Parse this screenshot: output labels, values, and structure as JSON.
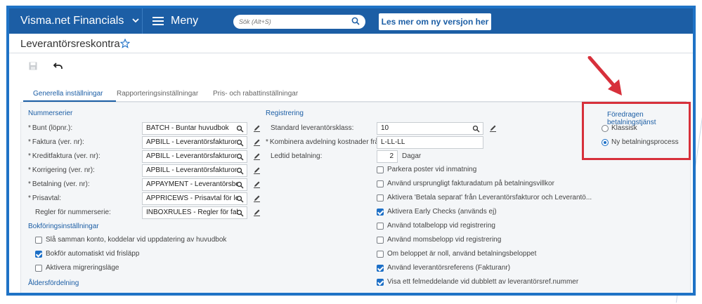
{
  "topbar": {
    "brand": "Visma.net Financials",
    "menu_label": "Meny",
    "search_placeholder": "Sök (Alt+S)",
    "new_version_button": "Les mer om ny versjon her"
  },
  "page": {
    "title": "Leverantörsreskontra"
  },
  "tabs": [
    {
      "label": "Generella inställningar",
      "active": true
    },
    {
      "label": "Rapporteringsinställningar",
      "active": false
    },
    {
      "label": "Pris- och rabattinställningar",
      "active": false
    }
  ],
  "numbering": {
    "section": "Nummerserier",
    "rows": [
      {
        "label": "Bunt (löpnr.):",
        "required": "*",
        "value": "BATCH - Buntar huvudbok"
      },
      {
        "label": "Faktura (ver. nr):",
        "required": "*",
        "value": "APBILL - Leverantörsfakturor"
      },
      {
        "label": "Kreditfaktura (ver. nr):",
        "required": "*",
        "value": "APBILL - Leverantörsfakturor"
      },
      {
        "label": "Korrigering (ver. nr):",
        "required": "*",
        "value": "APBILL - Leverantörsfakturor"
      },
      {
        "label": "Betalning (ver. nr):",
        "required": "*",
        "value": "APPAYMENT - Leverantörsbeta"
      },
      {
        "label": "Prisavtal:",
        "required": "*",
        "value": "APPRICEWS - Prisavtal för leve"
      },
      {
        "label": "Regler för nummerserie:",
        "required": "",
        "value": "INBOXRULES - Regler för faktu"
      }
    ]
  },
  "posting": {
    "section": "Bokföringsinställningar",
    "options": [
      {
        "label": "Slå samman konto, koddelar vid uppdatering av huvudbok",
        "checked": false
      },
      {
        "label": "Bokför automatiskt vid frisläpp",
        "checked": true
      },
      {
        "label": "Aktivera migreringsläge",
        "checked": false
      }
    ]
  },
  "aging": {
    "section": "Åldersfördelning"
  },
  "registration": {
    "section": "Registrering",
    "default_class_label": "Standard leverantörsklass:",
    "default_class_value": "10",
    "combine_label": "Kombinera avdelning kostnader från:",
    "combine_required": "*",
    "combine_value": "L-LL-LL",
    "lead_time_label": "Ledtid betalning:",
    "lead_time_value": "2",
    "lead_time_unit": "Dagar",
    "options": [
      {
        "label": "Parkera poster vid inmatning",
        "checked": false
      },
      {
        "label": "Använd ursprungligt fakturadatum på betalningsvillkor",
        "checked": false
      },
      {
        "label": "Aktivera 'Betala separat' från Leverantörsfakturor och Leverantö...",
        "checked": false
      },
      {
        "label": "Aktivera Early Checks (används ej)",
        "checked": true
      },
      {
        "label": "Använd totalbelopp vid registrering",
        "checked": false
      },
      {
        "label": "Använd momsbelopp vid registrering",
        "checked": false
      },
      {
        "label": "Om beloppet är noll, använd betalningsbeloppet",
        "checked": false
      },
      {
        "label": "Använd leverantörsreferens (Fakturanr)",
        "checked": true
      },
      {
        "label": "Visa ett felmeddelande vid dubblett av leverantörsref.nummer",
        "checked": true
      }
    ]
  },
  "payment_service": {
    "section": "Föredragen betalningstjänst",
    "options": [
      {
        "label": "Klassisk",
        "selected": false
      },
      {
        "label": "Ny betalningsprocess",
        "selected": true
      }
    ]
  },
  "colors": {
    "brand_blue": "#1c5ea5",
    "highlight_red": "#d7303b",
    "frame_blue": "#1f73c6"
  }
}
